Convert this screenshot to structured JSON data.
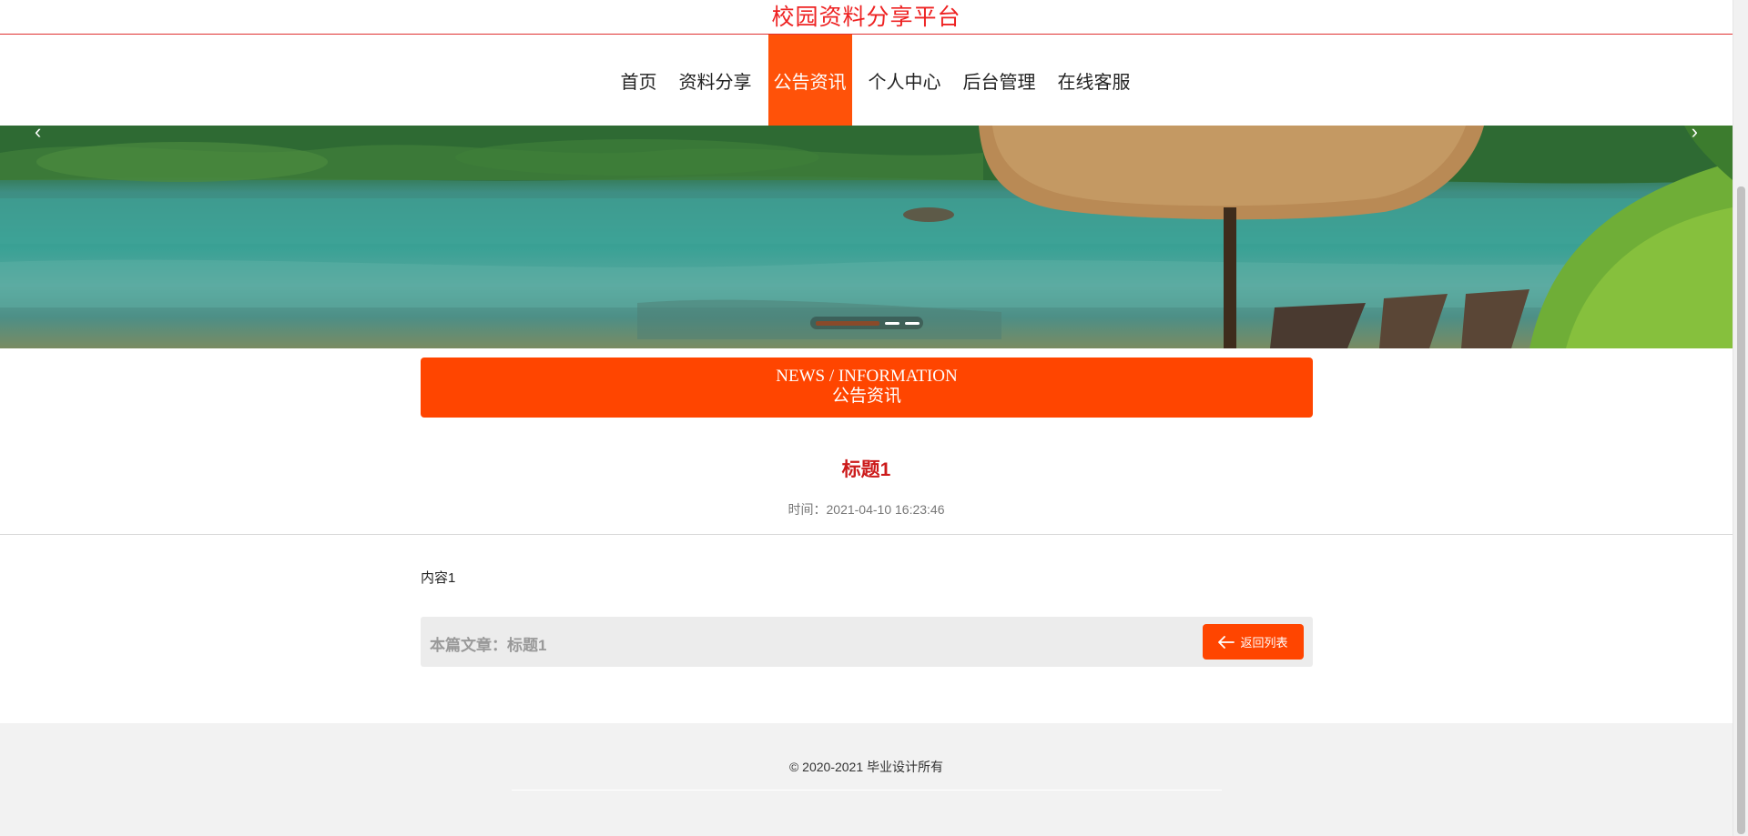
{
  "header": {
    "site_title": "校园资料分享平台"
  },
  "nav": {
    "items": [
      {
        "label": "首页",
        "active": false
      },
      {
        "label": "资料分享",
        "active": false
      },
      {
        "label": "公告资讯",
        "active": true
      },
      {
        "label": "个人中心",
        "active": false
      },
      {
        "label": "后台管理",
        "active": false
      },
      {
        "label": "在线客服",
        "active": false
      }
    ]
  },
  "banner": {
    "left_arrow": "‹",
    "right_arrow": "›",
    "slide_count": 3,
    "active_slide": 1
  },
  "section": {
    "title_en": "NEWS / INFORMATION",
    "title_cn": "公告资讯"
  },
  "article": {
    "title": "标题1",
    "time": "时间：2021-04-10 16:23:46",
    "content": "内容1",
    "current_label": "本篇文章：标题1",
    "back_button": "返回列表"
  },
  "footer": {
    "copyright": "© 2020-2021 毕业设计所有"
  },
  "colors": {
    "accent": "#ff4500",
    "title_red": "#ee2222",
    "article_title": "#cc1b1b"
  }
}
